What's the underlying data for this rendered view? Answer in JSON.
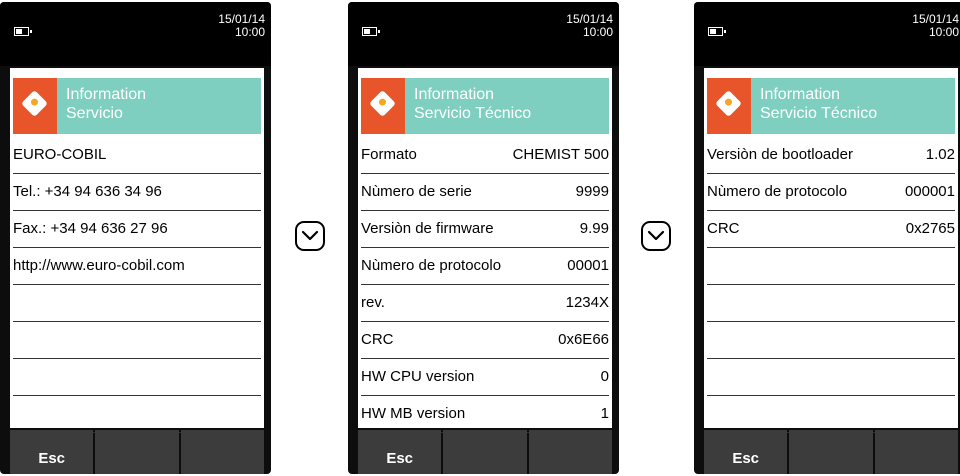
{
  "screens": [
    {
      "date": "15/01/14",
      "time": "10:00",
      "header_line1": "Information",
      "header_line2": "Servicio",
      "rows": [
        {
          "label": "EURO-COBIL",
          "value": ""
        },
        {
          "label": "Tel.: +34 94 636 34 96",
          "value": ""
        },
        {
          "label": "Fax.: +34 94 636 27 96",
          "value": ""
        },
        {
          "label": "http://www.euro-cobil.com",
          "value": ""
        },
        {
          "label": "",
          "value": ""
        },
        {
          "label": "",
          "value": ""
        },
        {
          "label": "",
          "value": ""
        },
        {
          "label": "",
          "value": ""
        }
      ],
      "softkeys": [
        "Esc",
        "",
        ""
      ]
    },
    {
      "date": "15/01/14",
      "time": "10:00",
      "header_line1": "Information",
      "header_line2": "Servicio Técnico",
      "rows": [
        {
          "label": "Formato",
          "value": "CHEMIST 500"
        },
        {
          "label": "Nùmero de serie",
          "value": "9999"
        },
        {
          "label": "Versiòn de firmware",
          "value": "9.99"
        },
        {
          "label": "Nùmero de protocolo",
          "value": "00001"
        },
        {
          "label": "rev.",
          "value": "1234X"
        },
        {
          "label": "CRC",
          "value": "0x6E66"
        },
        {
          "label": "HW CPU version",
          "value": "0"
        },
        {
          "label": "HW MB version",
          "value": "1"
        }
      ],
      "softkeys": [
        "Esc",
        "",
        ""
      ]
    },
    {
      "date": "15/01/14",
      "time": "10:00",
      "header_line1": "Information",
      "header_line2": "Servicio Técnico",
      "rows": [
        {
          "label": "Versiòn de bootloader",
          "value": "1.02"
        },
        {
          "label": "Nùmero de protocolo",
          "value": "000001"
        },
        {
          "label": "CRC",
          "value": "0x2765"
        },
        {
          "label": "",
          "value": ""
        },
        {
          "label": "",
          "value": ""
        },
        {
          "label": "",
          "value": ""
        },
        {
          "label": "",
          "value": ""
        },
        {
          "label": "",
          "value": ""
        }
      ],
      "softkeys": [
        "Esc",
        "",
        ""
      ]
    }
  ],
  "icons": {
    "battery": "battery-icon",
    "info": "info-tag-icon",
    "scroll_down": "chevron-down-icon"
  },
  "colors": {
    "header_bg": "#7ecfc0",
    "icon_bg": "#e8552a",
    "softkey_bg": "#3c3c3c",
    "device_bg": "#0d0d0d"
  }
}
